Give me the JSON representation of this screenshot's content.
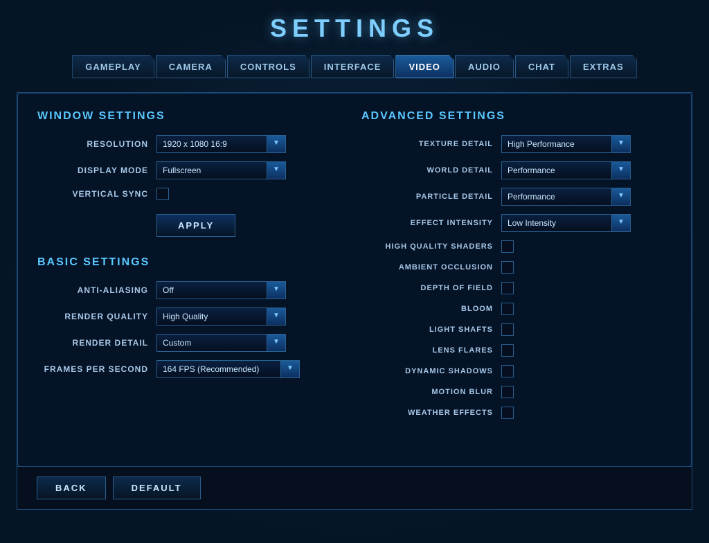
{
  "title": "SETTINGS",
  "tabs": [
    {
      "label": "GAMEPLAY",
      "active": false
    },
    {
      "label": "CAMERA",
      "active": false
    },
    {
      "label": "CONTROLS",
      "active": false
    },
    {
      "label": "INTERFACE",
      "active": false
    },
    {
      "label": "VIDEO",
      "active": true
    },
    {
      "label": "AUDIO",
      "active": false
    },
    {
      "label": "CHAT",
      "active": false
    },
    {
      "label": "EXTRAS",
      "active": false
    }
  ],
  "window_settings": {
    "title": "WINDOW SETTINGS",
    "resolution_label": "RESOLUTION",
    "resolution_value": "1920 x 1080 16:9",
    "display_mode_label": "DISPLAY MODE",
    "display_mode_value": "Fullscreen",
    "vertical_sync_label": "VERTICAL SYNC",
    "apply_label": "APPLY"
  },
  "basic_settings": {
    "title": "BASIC SETTINGS",
    "anti_aliasing_label": "ANTI-ALIASING",
    "anti_aliasing_value": "Off",
    "render_quality_label": "RENDER QUALITY",
    "render_quality_value": "High Quality",
    "render_detail_label": "RENDER DETAIL",
    "render_detail_value": "Custom",
    "fps_label": "FRAMES PER SECOND",
    "fps_value": "164  FPS (Recommended)"
  },
  "advanced_settings": {
    "title": "ADVANCED SETTINGS",
    "texture_detail_label": "TEXTURE DETAIL",
    "texture_detail_value": "High Performance",
    "world_detail_label": "WORLD DETAIL",
    "world_detail_value": "Performance",
    "particle_detail_label": "PARTICLE DETAIL",
    "particle_detail_value": "Performance",
    "effect_intensity_label": "EFFECT INTENSITY",
    "effect_intensity_value": "Low Intensity",
    "hq_shaders_label": "HIGH QUALITY SHADERS",
    "ambient_occlusion_label": "AMBIENT OCCLUSION",
    "depth_of_field_label": "DEPTH OF FIELD",
    "bloom_label": "BLOOM",
    "light_shafts_label": "LIGHT SHAFTS",
    "lens_flares_label": "LENS FLARES",
    "dynamic_shadows_label": "DYNAMIC SHADOWS",
    "motion_blur_label": "MOTION BLUR",
    "weather_effects_label": "WEATHER EFFECTS"
  },
  "bottom": {
    "back_label": "BACK",
    "default_label": "DEFAULT"
  }
}
